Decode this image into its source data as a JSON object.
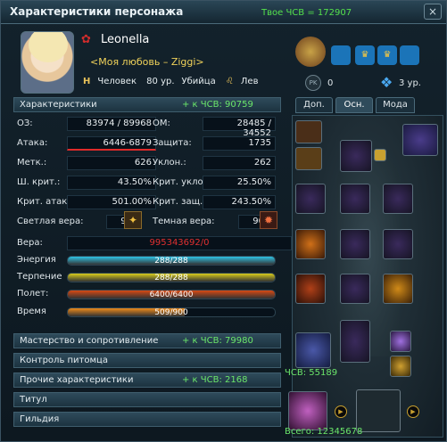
{
  "title": "Характеристики персонажа",
  "title_cp": "Твое ЧСВ = 172907",
  "close": "×",
  "character": {
    "name": "Leonella",
    "guild": "<Моя любовь – Ziggi>",
    "race": "Человек",
    "level": "80 ур.",
    "class": "Убийца",
    "zodiac": "Лев",
    "pk_label": "PK",
    "pk": "0",
    "rank_level": "3 ур."
  },
  "tabs": [
    "Доп.",
    "Осн.",
    "Мода"
  ],
  "sections": {
    "characteristics": "Характеристики",
    "characteristics_cp": "+ к ЧСВ: 90759"
  },
  "stats": {
    "hp_l": "ОЗ:",
    "hp": "83974 / 89968",
    "mp_l": "ОМ:",
    "mp": "28485 / 34552",
    "atk_l": "Атака:",
    "atk": "6446-6879",
    "def_l": "Защита:",
    "def": "1735",
    "acc_l": "Метк.:",
    "acc": "626",
    "eva_l": "Уклон.:",
    "eva": "262",
    "crit_l": "Ш. крит.:",
    "crit": "43.50%",
    "critev_l": "Крит. уклон.:",
    "critev": "25.50%",
    "critatk_l": "Крит. атака:",
    "critatk": "501.00%",
    "critdef_l": "Крит. защ.:",
    "critdef": "243.50%",
    "light_l": "Светлая вера:",
    "light": "90",
    "dark_l": "Темная вера:",
    "dark": "90",
    "faith_l": "Вера:",
    "faith": "995343692/0"
  },
  "bars": [
    {
      "label": "Энергия",
      "text": "288/288",
      "fraction": 1.0,
      "color": "#2ec3e6"
    },
    {
      "label": "Терпение",
      "text": "288/288",
      "fraction": 1.0,
      "color": "#d8cc1c"
    },
    {
      "label": "Полет:",
      "text": "6400/6400",
      "fraction": 1.0,
      "color": "#d84a14"
    },
    {
      "label": "Время",
      "text": "509/900",
      "fraction": 0.566,
      "color": "#ee8a1a"
    }
  ],
  "collapsed": [
    {
      "label": "Мастерство и сопротивление",
      "cp": "+ к ЧСВ: 79980"
    },
    {
      "label": "Контроль питомца",
      "cp": ""
    },
    {
      "label": "Прочие характеристики",
      "cp": "+ к ЧСВ: 2168"
    },
    {
      "label": "Титул",
      "cp": ""
    },
    {
      "label": "Гильдия",
      "cp": ""
    }
  ],
  "equip": {
    "cp": "ЧСВ: 55189",
    "total": "Всего: 12345678"
  }
}
